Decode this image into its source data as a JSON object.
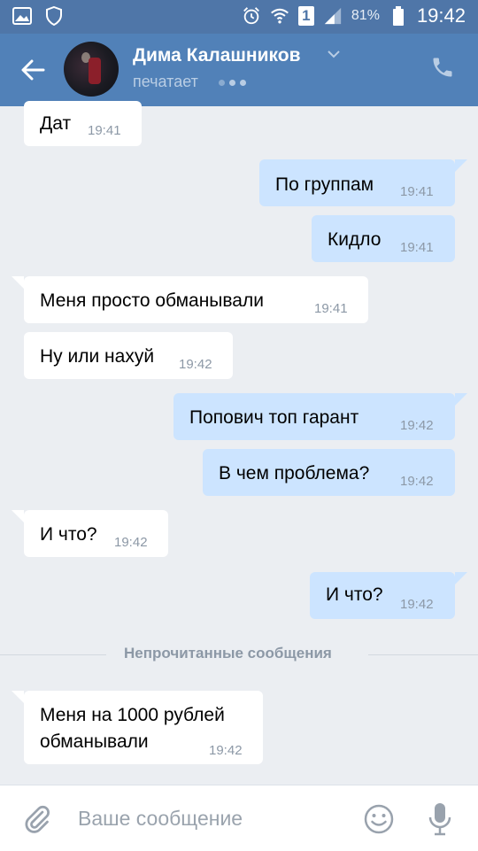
{
  "status_bar": {
    "battery_pct": "81%",
    "time": "19:42",
    "icons": [
      "gallery-icon",
      "shield-icon",
      "alarm-icon",
      "wifi-icon",
      "sim-1-icon",
      "signal-icon",
      "battery-icon"
    ]
  },
  "header": {
    "contact_name": "Дима Калашников",
    "status": "печатает",
    "colors": {
      "header_bg": "#5181b8",
      "status_bar_bg": "#4f76a8"
    }
  },
  "messages": [
    {
      "direction": "in",
      "text": "Дат",
      "time": "19:41"
    },
    {
      "direction": "out",
      "text": "По группам",
      "time": "19:41"
    },
    {
      "direction": "out",
      "text": "Кидло",
      "time": "19:41"
    },
    {
      "direction": "in",
      "text": "Меня просто обманывали",
      "time": "19:41"
    },
    {
      "direction": "in",
      "text": "Ну или нахуй",
      "time": "19:42"
    },
    {
      "direction": "out",
      "text": "Попович топ гарант",
      "time": "19:42"
    },
    {
      "direction": "out",
      "text": "В чем проблема?",
      "time": "19:42"
    },
    {
      "direction": "in",
      "text": "И что?",
      "time": "19:42"
    },
    {
      "direction": "out",
      "text": "И что?",
      "time": "19:42"
    },
    {
      "direction": "in",
      "text_line1": "Меня на 1000 рублей",
      "text_line2": "обманывали",
      "time": "19:42"
    }
  ],
  "divider": {
    "label": "Непрочитанные сообщения"
  },
  "composer": {
    "placeholder": "Ваше сообщение"
  },
  "colors": {
    "incoming_bubble": "#ffffff",
    "outgoing_bubble": "#cce4ff",
    "chat_bg": "#ebeef2"
  }
}
